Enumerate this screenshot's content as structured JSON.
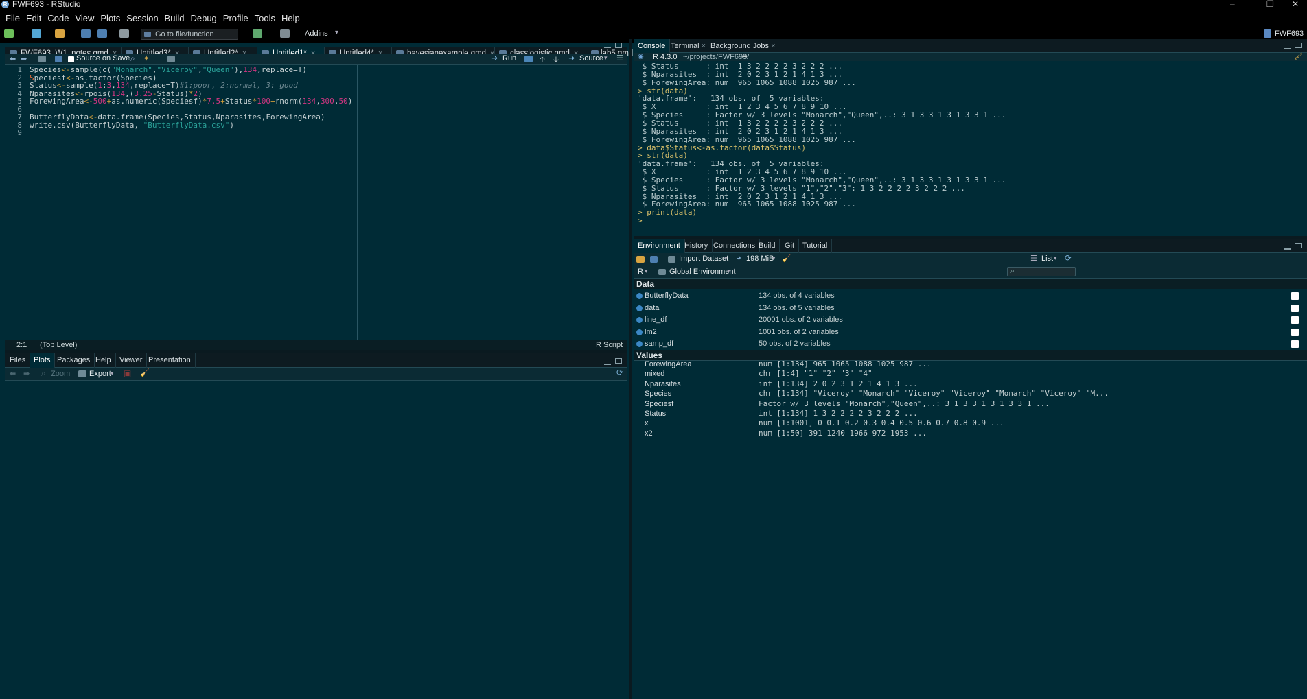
{
  "window": {
    "title": "FWF693 - RStudio",
    "controls": [
      "–",
      "❐",
      "✕"
    ]
  },
  "menu": [
    "File",
    "Edit",
    "Code",
    "View",
    "Plots",
    "Session",
    "Build",
    "Debug",
    "Profile",
    "Tools",
    "Help"
  ],
  "toolbar": {
    "goto_label": "Go to file/function",
    "addins_label": "Addins",
    "project_label": "FWF693"
  },
  "editor": {
    "tabs": [
      {
        "label": "FWF693_W1_notes.qmd",
        "active": false
      },
      {
        "label": "Untitled3*",
        "active": false
      },
      {
        "label": "Untitled2*",
        "active": false
      },
      {
        "label": "Untitled1*",
        "active": true
      },
      {
        "label": "Untitled4*",
        "active": false
      },
      {
        "label": "bayesianexample.qmd",
        "active": false
      },
      {
        "label": "classlogistic.qmd",
        "active": false
      },
      {
        "label": "lab5.qmd",
        "active": false
      }
    ],
    "source_on_save": "Source on Save",
    "run_label": "Run",
    "source_label": "Source",
    "line_numbers": [
      "1",
      "2",
      "3",
      "4",
      "5",
      "6",
      "7",
      "8",
      "9"
    ],
    "status": {
      "position": "2:1",
      "scope": "(Top Level)",
      "filetype": "R Script"
    }
  },
  "console": {
    "tabs": [
      "Console",
      "Terminal",
      "Background Jobs"
    ],
    "r_version": "R 4.3.0",
    "path": "~/projects/FWF693/",
    "lines": [
      " $ Status      : int  1 3 2 2 2 2 3 2 2 2 ...",
      " $ Nparasites  : int  2 0 2 3 1 2 1 4 1 3 ...",
      " $ ForewingArea: num  965 1065 1088 1025 987 ...",
      "> str(data)",
      "'data.frame':   134 obs. of  5 variables:",
      " $ X           : int  1 2 3 4 5 6 7 8 9 10 ...",
      " $ Species     : Factor w/ 3 levels \"Monarch\",\"Queen\",..: 3 1 3 3 1 3 1 3 3 1 ...",
      " $ Status      : int  1 3 2 2 2 2 3 2 2 2 ...",
      " $ Nparasites  : int  2 0 2 3 1 2 1 4 1 3 ...",
      " $ ForewingArea: num  965 1065 1088 1025 987 ...",
      "> data$Status<-as.factor(data$Status)",
      "> str(data)",
      "'data.frame':   134 obs. of  5 variables:",
      " $ X           : int  1 2 3 4 5 6 7 8 9 10 ...",
      " $ Species     : Factor w/ 3 levels \"Monarch\",\"Queen\",..: 3 1 3 3 1 3 1 3 3 1 ...",
      " $ Status      : Factor w/ 3 levels \"1\",\"2\",\"3\": 1 3 2 2 2 2 3 2 2 2 ...",
      " $ Nparasites  : int  2 0 2 3 1 2 1 4 1 3 ...",
      " $ ForewingArea: num  965 1065 1088 1025 987 ...",
      "> print(data)",
      "> "
    ]
  },
  "environment": {
    "tabs": [
      "Environment",
      "History",
      "Connections",
      "Build",
      "Git",
      "Tutorial"
    ],
    "import_label": "Import Dataset",
    "memory_label": "198 MiB",
    "list_label": "List",
    "lang_label": "R",
    "scope_label": "Global Environment",
    "data_header": "Data",
    "values_header": "Values",
    "data": [
      {
        "name": "ButterflyData",
        "value": "134 obs. of 4 variables"
      },
      {
        "name": "data",
        "value": "134 obs. of 5 variables"
      },
      {
        "name": "line_df",
        "value": "20001 obs. of 2 variables"
      },
      {
        "name": "lm2",
        "value": "1001 obs. of 2 variables"
      },
      {
        "name": "samp_df",
        "value": "50 obs. of 2 variables"
      }
    ],
    "values": [
      {
        "name": "ForewingArea",
        "value": "num [1:134] 965 1065 1088 1025 987 ..."
      },
      {
        "name": "mixed",
        "value": "chr [1:4] \"1\" \"2\" \"3\" \"4\""
      },
      {
        "name": "Nparasites",
        "value": "int [1:134] 2 0 2 3 1 2 1 4 1 3 ..."
      },
      {
        "name": "Species",
        "value": "chr [1:134] \"Viceroy\" \"Monarch\" \"Viceroy\" \"Viceroy\" \"Monarch\" \"Viceroy\" \"M..."
      },
      {
        "name": "Speciesf",
        "value": "Factor w/ 3 levels \"Monarch\",\"Queen\",..: 3 1 3 3 1 3 1 3 3 1 ..."
      },
      {
        "name": "Status",
        "value": "int [1:134] 1 3 2 2 2 2 3 2 2 2 ..."
      },
      {
        "name": "x",
        "value": "num [1:1001] 0 0.1 0.2 0.3 0.4 0.5 0.6 0.7 0.8 0.9 ..."
      },
      {
        "name": "x2",
        "value": "num [1:50] 391 1240 1966 972 1953 ..."
      }
    ]
  },
  "files": {
    "tabs": [
      "Files",
      "Plots",
      "Packages",
      "Help",
      "Viewer",
      "Presentation"
    ],
    "zoom_label": "Zoom",
    "export_label": "Export"
  }
}
